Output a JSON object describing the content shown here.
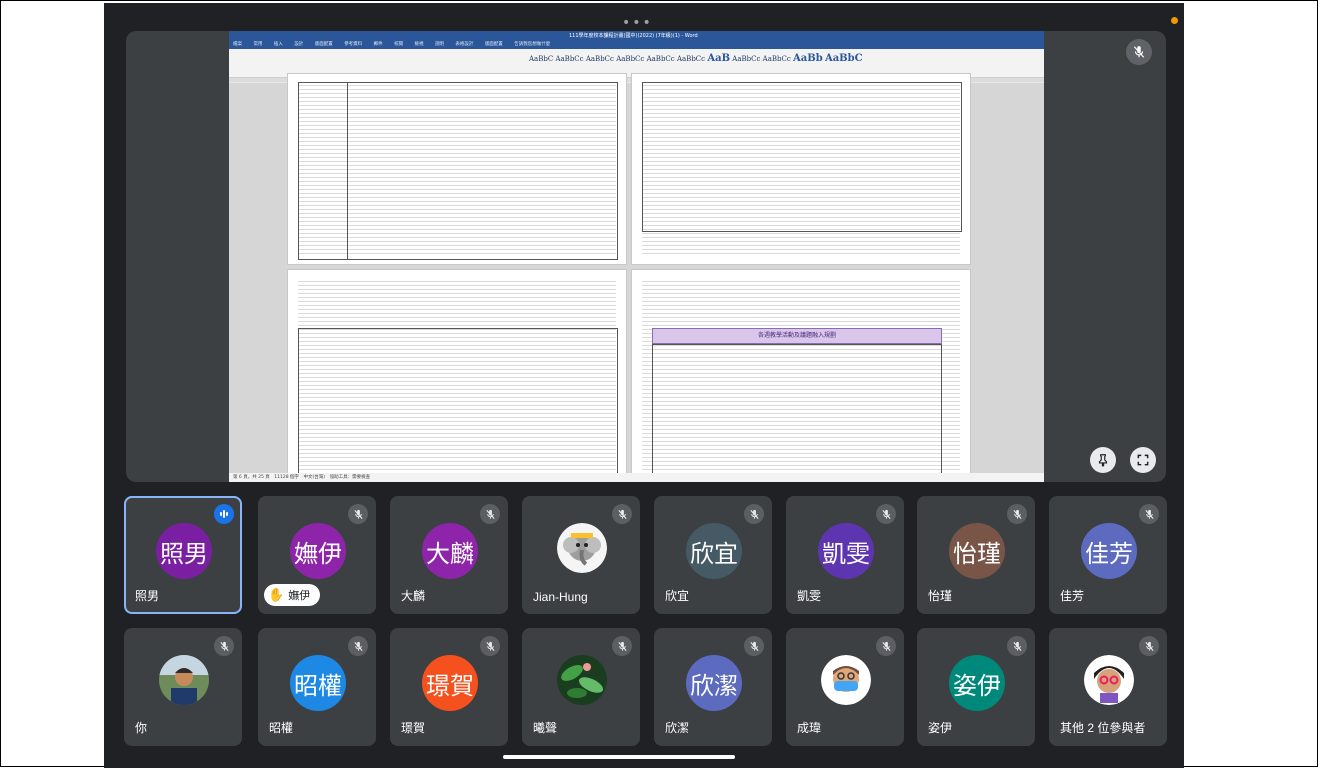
{
  "word": {
    "title": "111學年度校本課程計畫(國中)(2022) (7年級)(1) - Word",
    "menu": [
      "檔案",
      "常用",
      "插入",
      "設計",
      "版面配置",
      "參考資料",
      "郵件",
      "校閱",
      "檢視",
      "說明",
      "表格設計",
      "版面配置",
      "告訴我您想做什麼"
    ],
    "styles": [
      "AaBbC",
      "AaBbCc",
      "AaBbCc",
      "AaBbCc",
      "AaBbCc",
      "AaBbCc",
      "AaB",
      "AaBbCc",
      "AaBbCc",
      "AaBb",
      "AaBbC"
    ],
    "banner": "各週教學活動及議題融入規劃",
    "statusbar": "第 6 頁，共 25 頁　11128 個字　中文(台灣)　協助工具：需要檢查"
  },
  "tiles": [
    {
      "label": "照男",
      "name": "照男",
      "color": "#7b1fa2",
      "speaking": true
    },
    {
      "label": "嫵伊",
      "name": "嫵伊",
      "color": "#8e24aa",
      "hand": true
    },
    {
      "label": "大麟",
      "name": "大麟",
      "color": "#8e24aa"
    },
    {
      "label": "",
      "name": "Jian-Hung",
      "photo": "elephant"
    },
    {
      "label": "欣宜",
      "name": "欣宜",
      "color": "#455a64"
    },
    {
      "label": "凱雯",
      "name": "凱雯",
      "color": "#5e35b1"
    },
    {
      "label": "怡瑾",
      "name": "怡瑾",
      "color": "#795548"
    },
    {
      "label": "佳芳",
      "name": "佳芳",
      "color": "#5c6bc0"
    },
    {
      "label": "",
      "name": "你",
      "photo": "person"
    },
    {
      "label": "昭權",
      "name": "昭權",
      "color": "#1e88e5"
    },
    {
      "label": "璟賀",
      "name": "璟賀",
      "color": "#f4511e"
    },
    {
      "label": "",
      "name": "曦聲",
      "photo": "plant"
    },
    {
      "label": "欣潔",
      "name": "欣潔",
      "color": "#5c6bc0"
    },
    {
      "label": "",
      "name": "成瑋",
      "photo": "memoji"
    },
    {
      "label": "姿伊",
      "name": "姿伊",
      "color": "#00897b"
    },
    {
      "label": "",
      "name": "其他 2 位參與者",
      "photo": "memoji2"
    }
  ],
  "icons": {
    "muted": "mic-off-icon",
    "speaking": "audio-wave-icon",
    "pin": "pin-icon",
    "fullscreen": "fullscreen-icon",
    "hand": "raised-hand-icon"
  }
}
